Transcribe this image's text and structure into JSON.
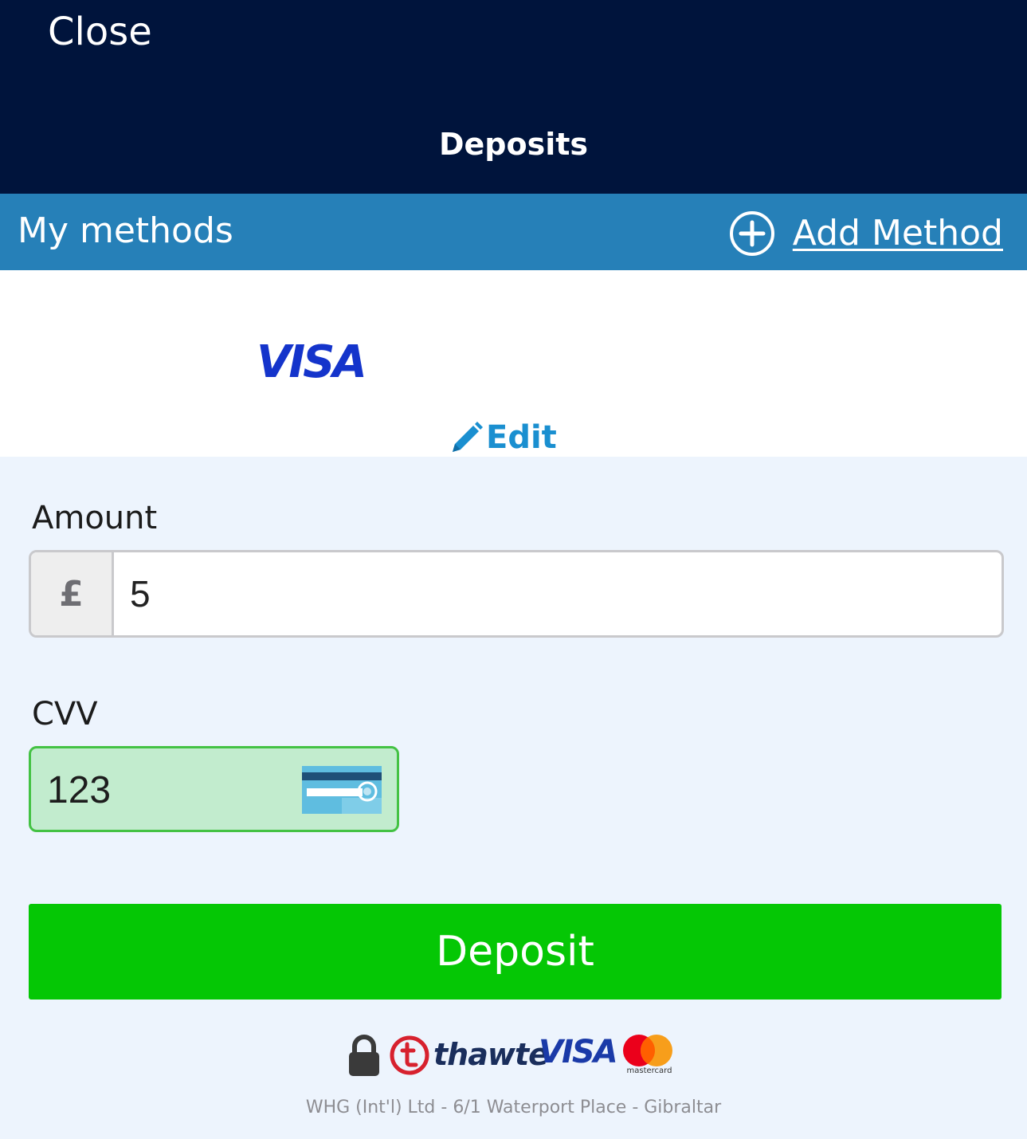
{
  "header": {
    "close_label": "Close",
    "title": "Deposits",
    "background": "#00143c"
  },
  "methods_bar": {
    "title": "My methods",
    "add_label": "Add Method",
    "add_icon": "plus-circle-icon",
    "background": "#2680b8"
  },
  "saved_method": {
    "brand_label": "VISA",
    "edit_label": "Edit",
    "edit_icon": "pencil-icon"
  },
  "form": {
    "amount_label": "Amount",
    "currency_symbol": "£",
    "amount_value": "5",
    "cvv_label": "CVV",
    "cvv_value": "123",
    "cvv_icon": "card-back-icon",
    "cvv_valid_color": "#44c244"
  },
  "deposit_button": {
    "label": "Deposit",
    "color": "#05c705"
  },
  "trust_badges": {
    "lock_icon": "lock-icon",
    "thawte_label": "thawte",
    "visa_label": "VISA",
    "mastercard_label": "mastercard"
  },
  "footer": {
    "text": "WHG (Int'l) Ltd - 6/1 Waterport Place - Gibraltar"
  }
}
